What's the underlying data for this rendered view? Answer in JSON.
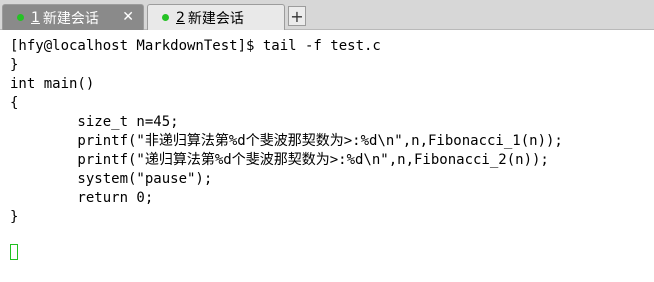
{
  "tabs": [
    {
      "number": "1",
      "title": "新建会话",
      "close": "✕"
    },
    {
      "number": "2",
      "title": "新建会话"
    }
  ],
  "add_tab_label": "+",
  "terminal": {
    "lines": [
      "[hfy@localhost MarkdownTest]$ tail -f test.c",
      "}",
      "int main()",
      "{",
      "        size_t n=45;",
      "        printf(\"非递归算法第%d个斐波那契数为>:%d\\n\",n,Fibonacci_1(n));",
      "        printf(\"递归算法第%d个斐波那契数为>:%d\\n\",n,Fibonacci_2(n));",
      "        system(\"pause\");",
      "        return 0;",
      "}"
    ]
  },
  "colors": {
    "tab_status_dot": "#25c225",
    "cursor_outline": "#20c020",
    "active_tab_bg": "#8a8a8a"
  }
}
